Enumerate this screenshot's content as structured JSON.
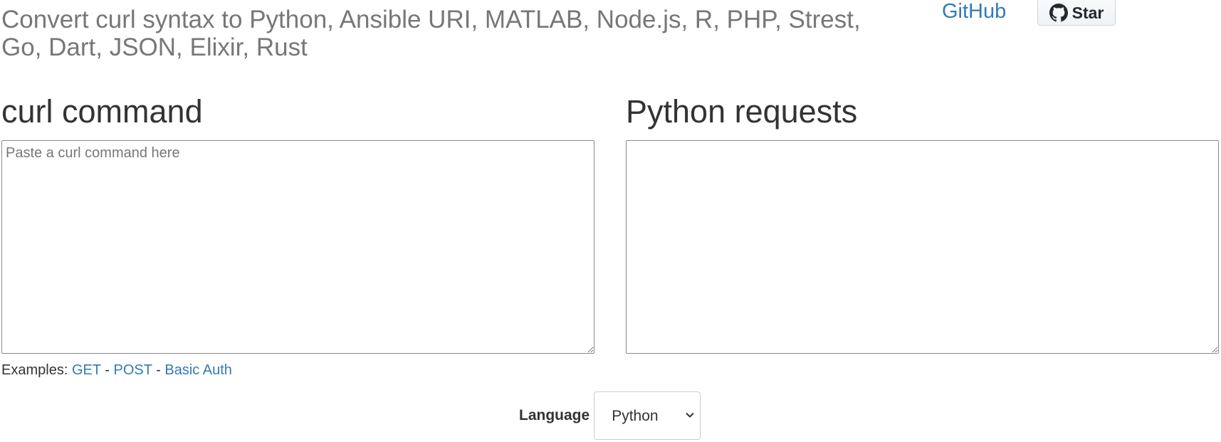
{
  "header": {
    "subtitle": "Convert curl syntax to Python, Ansible URI, MATLAB, Node.js, R, PHP, Strest, Go, Dart, JSON, Elixir, Rust",
    "github_link": "GitHub",
    "star_label": "Star"
  },
  "input_panel": {
    "heading": "curl command",
    "placeholder": "Paste a curl command here",
    "value": ""
  },
  "output_panel": {
    "heading": "Python requests",
    "value": ""
  },
  "examples": {
    "label": "Examples:",
    "separator": "-",
    "links": [
      "GET",
      "POST",
      "Basic Auth"
    ]
  },
  "language": {
    "label": "Language",
    "selected": "Python"
  },
  "colors": {
    "link": "#337ab7",
    "subtitle": "#777777",
    "text": "#333333"
  },
  "icons": {
    "github": "github-icon",
    "select_arrow": "chevron-down-icon"
  }
}
